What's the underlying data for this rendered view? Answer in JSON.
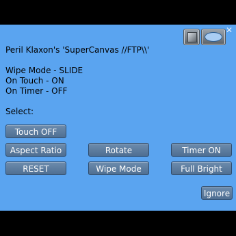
{
  "dialog": {
    "message_lines": [
      "Peril Klaxon's 'SuperCanvas //FTP\\\\'",
      "",
      "Wipe Mode - SLIDE",
      "On Touch - ON",
      "On Timer - OFF",
      "",
      "Select:"
    ],
    "close_glyph": "✕",
    "icons": [
      "object-cube-icon",
      "chat-bubble-icon"
    ],
    "buttons": {
      "touch_off": "Touch OFF",
      "aspect_ratio": "Aspect Ratio",
      "rotate": "Rotate",
      "timer_on": "Timer ON",
      "reset": "RESET",
      "wipe_mode": "Wipe Mode",
      "full_bright": "Full Bright",
      "ignore": "Ignore"
    }
  },
  "colors": {
    "dialog_background": "#5aa4f0",
    "button": "#5a7a9c",
    "screen_background": "#000000"
  }
}
